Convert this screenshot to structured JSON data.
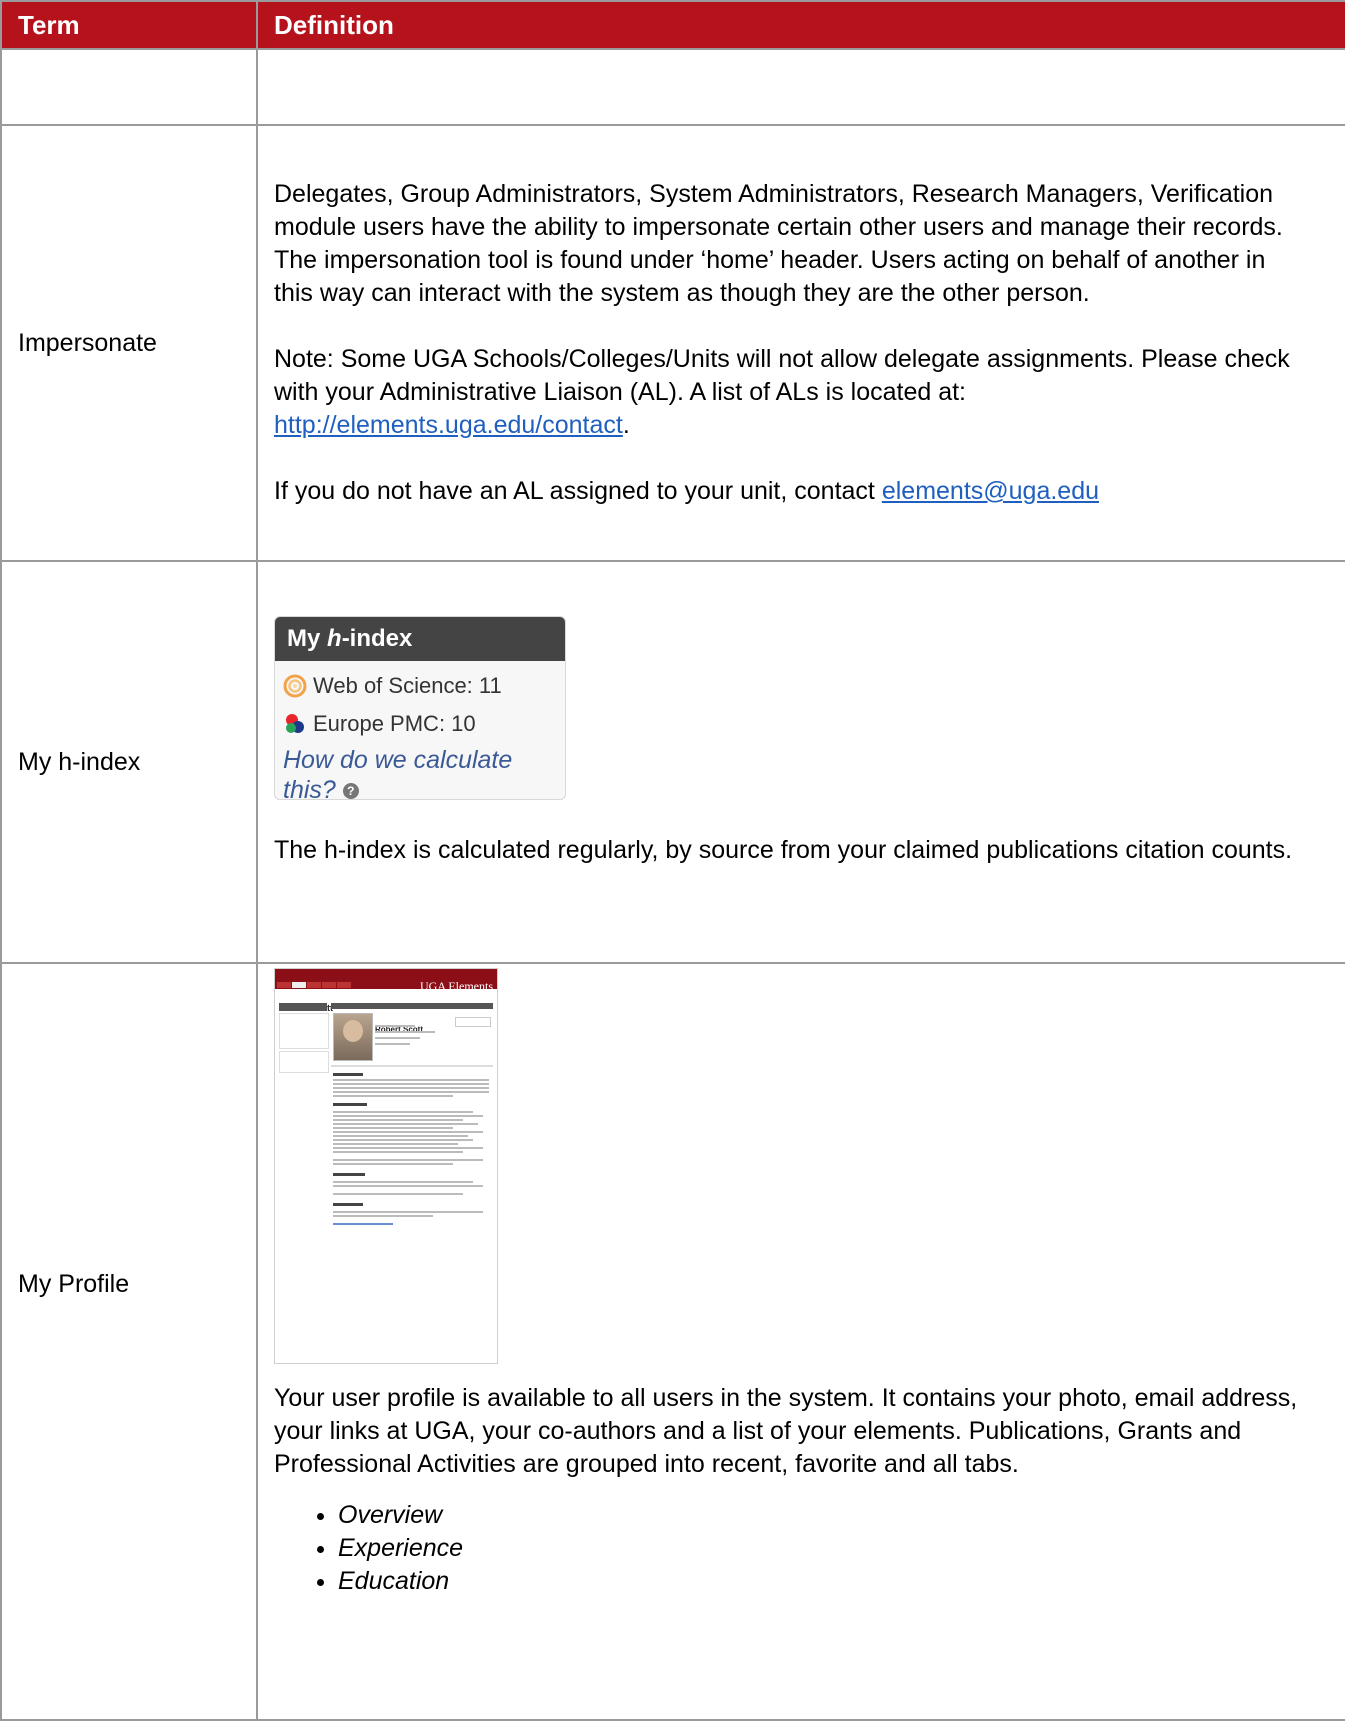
{
  "table": {
    "header": {
      "term": "Term",
      "definition": "Definition"
    },
    "rows": {
      "impersonate": {
        "term": "Impersonate",
        "p1": "Delegates, Group Administrators, System Administrators, Research Managers, Verification module users have the ability to impersonate certain other users and manage their records. The impersonation tool is found under ‘home’ header. Users acting on behalf of another in this way can interact with the system as though they are the other person.",
        "p2_text": "Note: Some UGA Schools/Colleges/Units will not allow delegate assignments. Please check with your Administrative Liaison (AL). A list of ALs is located at:",
        "p2_link": "http://elements.uga.edu/contact",
        "p2_end": ".",
        "p3_text": "If you do not have an AL assigned to your unit, contact",
        "p3_link": "elements@uga.edu"
      },
      "hindex": {
        "term": "My h-index",
        "widget": {
          "title_pre": "My ",
          "title_h": "h",
          "title_post": "-index",
          "wos": "Web of Science: 11",
          "pmc": "Europe PMC: 10",
          "calc": "How do we calculate this?",
          "qmark": "?"
        },
        "desc": "The h-index is calculated regularly, by source from your claimed publications citation counts."
      },
      "profile": {
        "term": "My Profile",
        "thumb": {
          "brand": "UGA Elements",
          "name": "Robert Scott"
        },
        "desc": "Your user profile is available to all users in the system. It contains your photo, email address, your links at UGA, your co-authors and a list of your elements. Publications, Grants and Professional Activities are grouped into recent, favorite and all tabs.",
        "bullets": [
          "Overview",
          "Experience",
          "Education"
        ]
      }
    }
  },
  "colors": {
    "header_bg": "#b5121b",
    "link": "#1f5fbf"
  },
  "icons": {
    "wos": "web-of-science-icon",
    "pmc": "europe-pmc-icon",
    "help": "help-icon"
  }
}
